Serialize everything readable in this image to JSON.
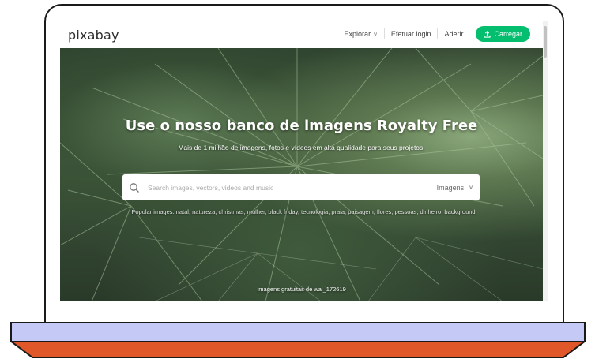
{
  "header": {
    "logo": "pixabay",
    "nav": {
      "explore": "Explorar",
      "login": "Efetuar login",
      "join": "Aderir",
      "upload": "Carregar"
    }
  },
  "hero": {
    "title": "Use o nosso banco de imagens Royalty Free",
    "subtitle": "Mais de 1 milhão de imagens, fotos e vídeos em alta qualidade para seus projetos.",
    "search": {
      "placeholder": "Search images, vectors, videos and music",
      "type_selected": "Imagens"
    },
    "popular": {
      "label": "Popular images:",
      "tags": [
        "natal",
        "natureza",
        "christmas",
        "mulher",
        "black friday",
        "tecnologia",
        "praia",
        "paisagem",
        "flores",
        "pessoas",
        "dinheiro",
        "background"
      ]
    },
    "credit": "Imagens gratuitas de wal_172619"
  },
  "colors": {
    "accent": "#02be6e",
    "laptop_base": "#c5c9f5",
    "laptop_foot": "#e0572a"
  }
}
